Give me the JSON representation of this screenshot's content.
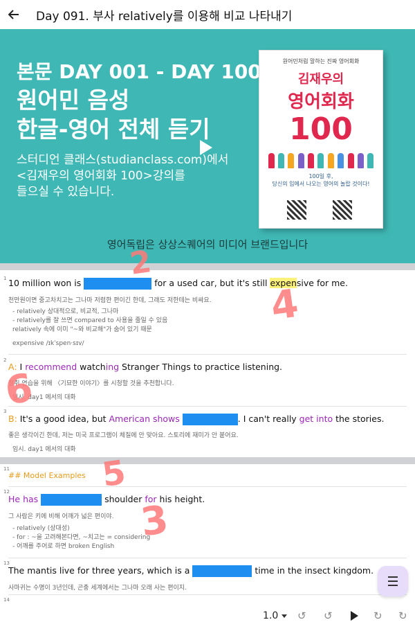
{
  "topbar": {
    "title": "Day 091. 부사 relatively를 이용해 비교 나타내기"
  },
  "hero": {
    "line1": "본문 DAY 001 - DAY 100",
    "line2a": "원어민 음성",
    "line2b": "한글-영어 전체 듣기",
    "line3a": "스터디언 클래스(studianclass.com)에서",
    "line3b": "<김재우의 영어회화 100>강의를",
    "line3c": "들으실 수 있습니다.",
    "footer": "영어독립은 상상스퀘어의 미디어 브랜드입니다",
    "book": {
      "publisher": "원어민처럼 말하는 진짜 영어회화",
      "title1": "김재우의",
      "title2": "영어회화",
      "title3": "100",
      "tag1": "100일 후,",
      "tag2": "당신의 입에서 나오는 영어의 놀랍 것이다!"
    }
  },
  "items": [
    {
      "num": "1",
      "s_pre": "10 million won is ",
      "s_mid": " for a used car, but it's still ",
      "s_hl_a": "expen",
      "s_hl_b": "sive for me.",
      "kr": "천만원이면 중고차치고는 그나마 저렴한 편이긴 한데, 그래도 저한테는 비싸요.",
      "note1": "- relatively 상대적으로, 비교적, 그나마",
      "note2": "- relatively를 잘 쓰면 compared to 사용을 줄일 수 있음",
      "note3": "relatively 속에 이미 \"~와 비교해\"가 숨어 있기 때문",
      "note4": "expensive /ɪkˈspen·sɪv/"
    },
    {
      "num": "2",
      "speaker": "A:",
      "s1": " I ",
      "s2": "recommend",
      "s3": " watch",
      "s4": "ing",
      "s5": " Stranger Things to practice listening.",
      "kr": "청취 연습을 위해 〈기묘한 이야기〉를 시청할 것을 추천합니다.",
      "src": "임시. day1 에서의 대화"
    },
    {
      "num": "3",
      "speaker": "B:",
      "s1": " It's a good idea, but ",
      "s2": "American shows",
      "s3": " ",
      "s4": ". I can't really ",
      "s5": "get into",
      "s6": " the stories.",
      "kr": "좋은 생각이긴 한데, 저는 미국 프로그램이 체질에 안 맞아요. 스토리에 재미가 안 붙어요.",
      "src": "임시. day1 에서의 대화"
    },
    {
      "num": "11",
      "heading": "## Model Examples"
    },
    {
      "num": "12",
      "s1": "He has",
      "s2": " shoulder ",
      "s3": "for",
      "s4": " his height.",
      "kr": "그 사람은 키에 비해 어깨가 넓은 편이야.",
      "note1": "- relatively (상대성)",
      "note2": "- for : ~을 고려해본다면, ~치고는 = considering",
      "note3": "- 어깨를 주어로 하면 broken English"
    },
    {
      "num": "13",
      "s1": "The mantis live for three years, which is a ",
      "s2": " time in the insect kingdom.",
      "kr": "사마귀는 수명이 3년인데, 곤충 세계에서는 그나마 오래 사는 편이지."
    },
    {
      "num": "14"
    }
  ],
  "marks": [
    "2",
    "4",
    "6",
    "5",
    "3"
  ],
  "player": {
    "speed": "1.0"
  },
  "colors": {
    "teal": "#3fb8b5",
    "blank": "#1f8ef1",
    "highlight": "#fff27a",
    "purple": "#9a27b5",
    "orange": "#e89b1a"
  }
}
